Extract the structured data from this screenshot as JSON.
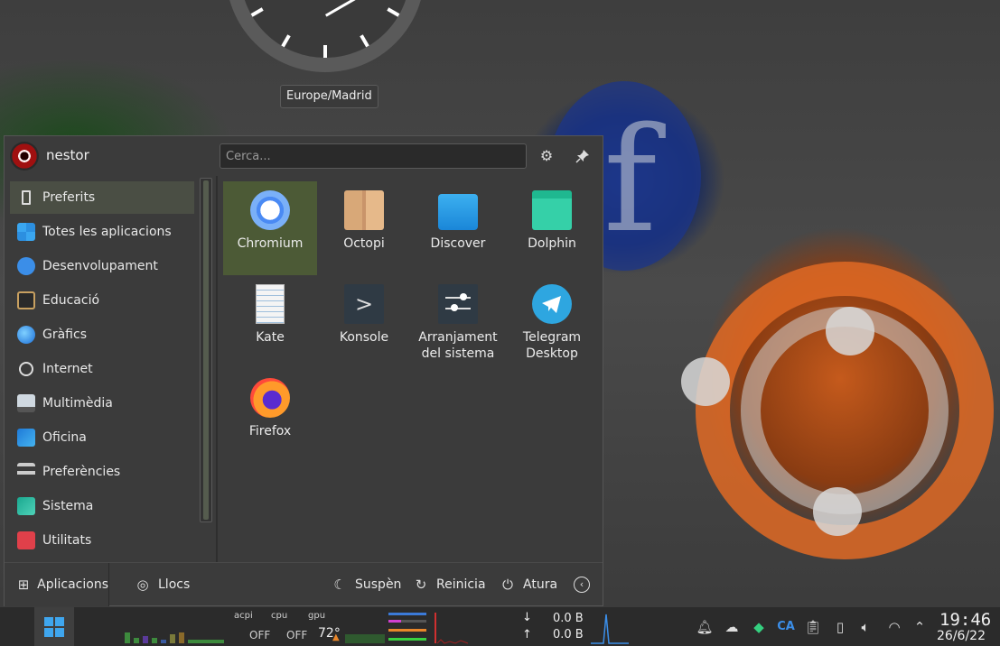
{
  "desktop": {
    "timezone_label": "Europe/Madrid"
  },
  "menu": {
    "user": {
      "name": "nestor"
    },
    "search": {
      "placeholder": "Cerca..."
    },
    "categories": [
      {
        "label": "Preferits",
        "icon": "bookmark-icon",
        "active": true
      },
      {
        "label": "Totes les aplicacions",
        "icon": "grid-apps-icon"
      },
      {
        "label": "Desenvolupament",
        "icon": "development-icon"
      },
      {
        "label": "Educació",
        "icon": "education-icon"
      },
      {
        "label": "Gràfics",
        "icon": "graphics-icon"
      },
      {
        "label": "Internet",
        "icon": "globe-icon"
      },
      {
        "label": "Multimèdia",
        "icon": "multimedia-icon"
      },
      {
        "label": "Oficina",
        "icon": "office-icon"
      },
      {
        "label": "Preferències",
        "icon": "preferences-icon"
      },
      {
        "label": "Sistema",
        "icon": "system-icon"
      },
      {
        "label": "Utilitats",
        "icon": "utilities-icon"
      }
    ],
    "apps": [
      {
        "label": "Chromium",
        "icon": "chromium-icon",
        "active": true
      },
      {
        "label": "Octopi",
        "icon": "octopi-icon"
      },
      {
        "label": "Discover",
        "icon": "discover-icon"
      },
      {
        "label": "Dolphin",
        "icon": "dolphin-icon"
      },
      {
        "label": "Kate",
        "icon": "kate-icon"
      },
      {
        "label": "Konsole",
        "icon": "konsole-icon"
      },
      {
        "label": "Arranjament del sistema",
        "icon": "system-settings-icon"
      },
      {
        "label": "Telegram Desktop",
        "icon": "telegram-icon"
      },
      {
        "label": "Firefox",
        "icon": "firefox-icon"
      }
    ],
    "footer": {
      "apps_tab": "Aplicacions",
      "places_tab": "Llocs",
      "suspend": "Suspèn",
      "restart": "Reinicia",
      "shutdown": "Atura"
    }
  },
  "taskbar": {
    "sensors": {
      "acpi_label": "acpi",
      "cpu_label": "cpu",
      "gpu_label": "gpu",
      "acpi_value": "OFF",
      "cpu_value": "OFF",
      "gpu_value": "72°"
    },
    "network": {
      "down": "0.0 B",
      "up": "0.0 B"
    },
    "tray": {
      "keyboard_layout": "CA"
    },
    "clock": {
      "time": "19:46",
      "date": "26/6/22"
    }
  },
  "colors": {
    "accent": "#4c5a36",
    "menu_bg": "#3b3b3b",
    "taskbar_bg": "#2b2b2b"
  }
}
